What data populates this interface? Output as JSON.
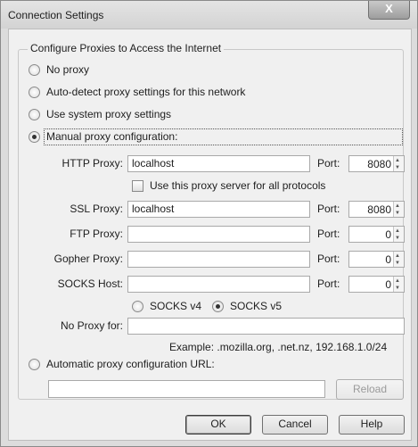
{
  "window": {
    "title": "Connection Settings",
    "close_label": "X"
  },
  "group": {
    "legend": "Configure Proxies to Access the Internet"
  },
  "radios": {
    "no_proxy": "No proxy",
    "auto_detect": "Auto-detect proxy settings for this network",
    "system": "Use system proxy settings",
    "manual": "Manual proxy configuration:",
    "auto_url": "Automatic proxy configuration URL:",
    "selected": "manual"
  },
  "proxies": {
    "http": {
      "label": "HTTP Proxy:",
      "value": "localhost",
      "port_label": "Port:",
      "port": "8080"
    },
    "share_all": {
      "label": "Use this proxy server for all protocols",
      "checked": false
    },
    "ssl": {
      "label": "SSL Proxy:",
      "value": "localhost",
      "port_label": "Port:",
      "port": "8080"
    },
    "ftp": {
      "label": "FTP Proxy:",
      "value": "",
      "port_label": "Port:",
      "port": "0"
    },
    "gopher": {
      "label": "Gopher Proxy:",
      "value": "",
      "port_label": "Port:",
      "port": "0"
    },
    "socks": {
      "label": "SOCKS Host:",
      "value": "",
      "port_label": "Port:",
      "port": "0"
    }
  },
  "socks_version": {
    "v4": "SOCKS v4",
    "v5": "SOCKS v5",
    "selected": "v5"
  },
  "no_proxy": {
    "label": "No Proxy for:",
    "value": "",
    "example": "Example: .mozilla.org, .net.nz, 192.168.1.0/24"
  },
  "auto_config": {
    "url": "",
    "reload_label": "Reload"
  },
  "buttons": {
    "ok": "OK",
    "cancel": "Cancel",
    "help": "Help"
  }
}
